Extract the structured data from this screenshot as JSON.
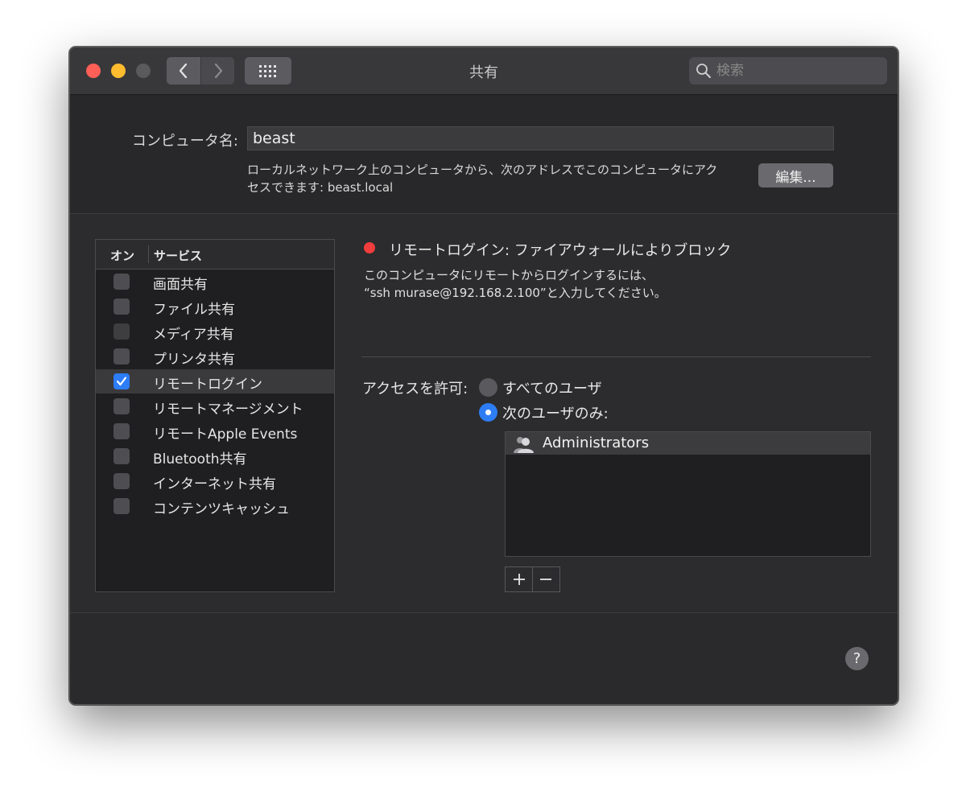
{
  "window": {
    "title": "共有"
  },
  "search": {
    "placeholder": "検索"
  },
  "computer_name": {
    "label": "コンピュータ名:",
    "value": "beast",
    "address_line1": "ローカルネットワーク上のコンピュータから、次のアドレスでこのコンピュータにアク",
    "address_line2": "セスできます: beast.local",
    "edit_label": "編集..."
  },
  "services": {
    "header_on": "オン",
    "header_service": "サービス",
    "items": [
      {
        "label": "画面共有",
        "checked": false
      },
      {
        "label": "ファイル共有",
        "checked": false
      },
      {
        "label": "メディア共有",
        "checked": false
      },
      {
        "label": "プリンタ共有",
        "checked": false
      },
      {
        "label": "リモートログイン",
        "checked": true,
        "selected": true
      },
      {
        "label": "リモートマネージメント",
        "checked": false
      },
      {
        "label": "リモートApple Events",
        "checked": false
      },
      {
        "label": "Bluetooth共有",
        "checked": false
      },
      {
        "label": "インターネット共有",
        "checked": false
      },
      {
        "label": "コンテンツキャッシュ",
        "checked": false
      }
    ]
  },
  "status": {
    "title": "リモートログイン: ファイアウォールによりブロック",
    "color": "#f13d3d",
    "desc_line1": "このコンピュータにリモートからログインするには、",
    "desc_line2": "“ssh murase@192.168.2.100”と入力してください。"
  },
  "access": {
    "label": "アクセスを許可:",
    "option_all": "すべてのユーザ",
    "option_some": "次のユーザのみ:",
    "selected": "option_some",
    "users": [
      "Administrators"
    ]
  },
  "accent": "#2d7df6"
}
